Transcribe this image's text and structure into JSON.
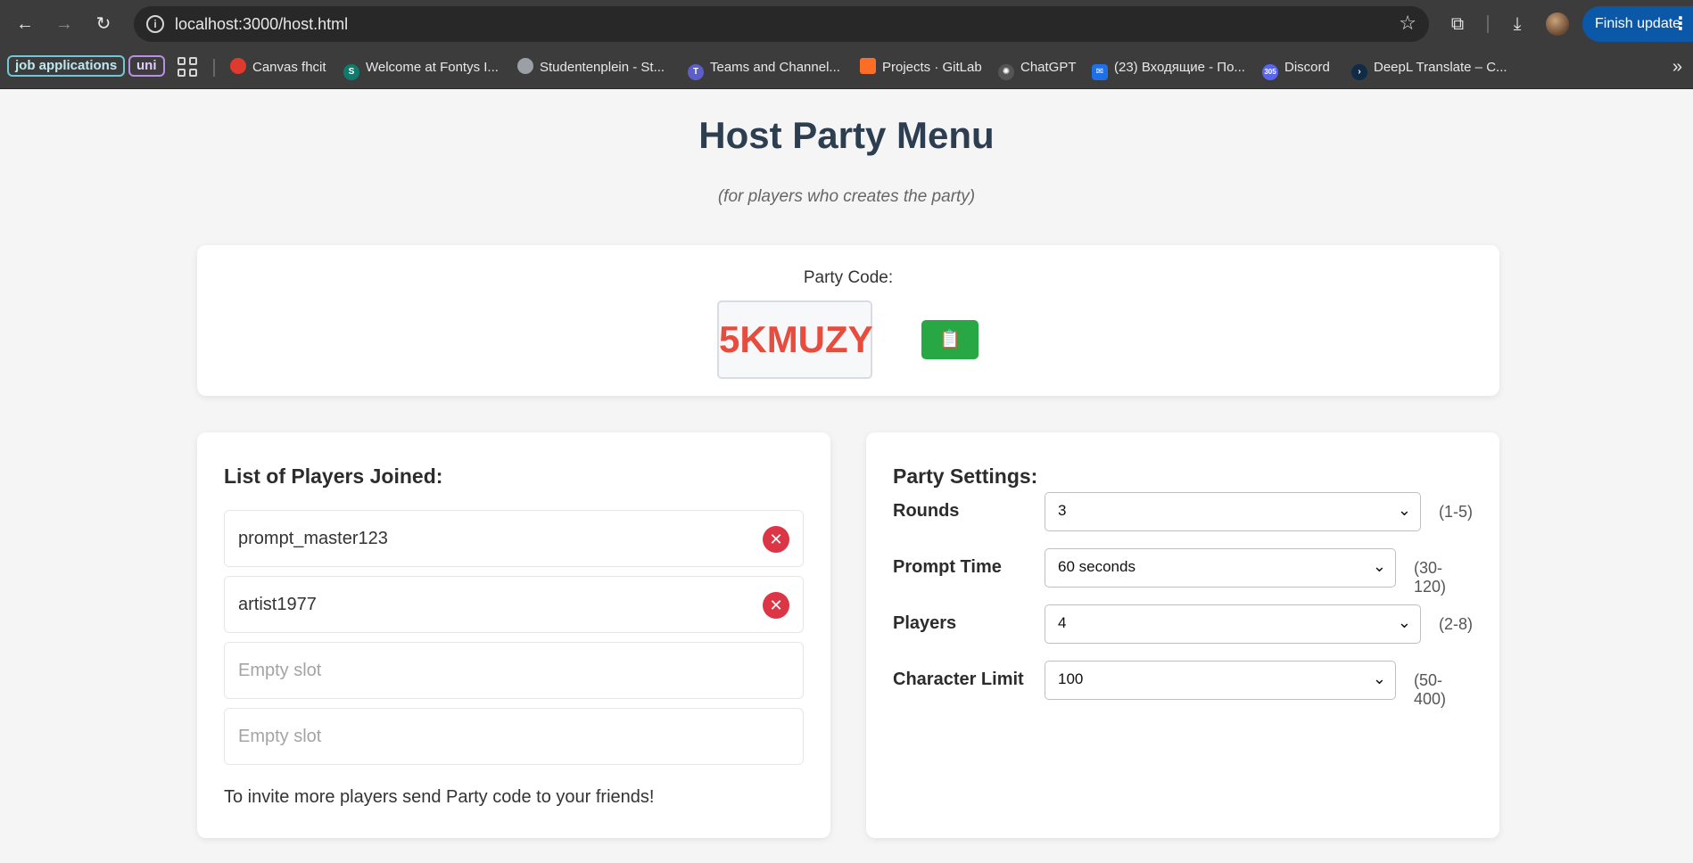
{
  "browser": {
    "url": "localhost:3000/host.html",
    "finish_update": "Finish update",
    "bookmarks": {
      "chips": [
        "job applications",
        "uni"
      ],
      "items": [
        "Canvas fhcit",
        "Welcome at Fontys I...",
        "Studentenplein - St...",
        "Teams and Channel...",
        "Projects · GitLab",
        "ChatGPT",
        "(23) Входящие - По...",
        "Discord",
        "DeepL Translate – C..."
      ],
      "discord_badge": "305"
    }
  },
  "page": {
    "title": "Host Party Menu",
    "subtitle": "(for players who creates the party)"
  },
  "party_code": {
    "label": "Party Code:",
    "code": "5KMUZY",
    "copy_icon": "📋"
  },
  "players": {
    "heading": "List of Players Joined:",
    "slots": [
      {
        "name": "prompt_master123"
      },
      {
        "name": "artist1977"
      },
      {
        "name": "Empty slot"
      },
      {
        "name": "Empty slot"
      }
    ],
    "invite_text": "To invite more players send Party code to your friends!"
  },
  "settings": {
    "heading": "Party Settings:",
    "rows": [
      {
        "label": "Rounds",
        "value": "3",
        "range": "(1-5)"
      },
      {
        "label": "Prompt Time",
        "value": "60 seconds",
        "range": "(30-120)"
      },
      {
        "label": "Players",
        "value": "4",
        "range": "(2-8)"
      },
      {
        "label": "Character Limit",
        "value": "100",
        "range": "(50-400)"
      }
    ]
  },
  "colors": {
    "code": "#e74c3c",
    "copy_button": "#28a745",
    "remove_button": "#dc3545",
    "title": "#2c3e50"
  }
}
